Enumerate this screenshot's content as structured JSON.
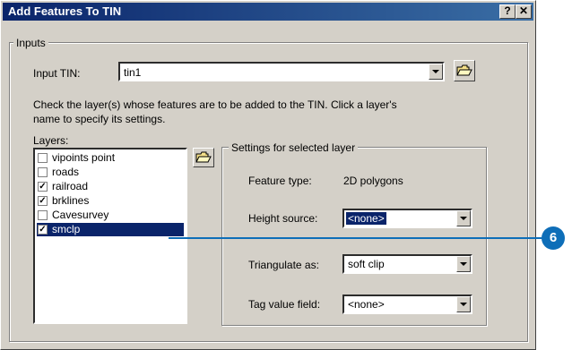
{
  "window": {
    "title": "Add Features To TIN",
    "help_label": "?",
    "close_label": "✕"
  },
  "inputs_group": {
    "label": "Inputs"
  },
  "input_tin": {
    "label": "Input TIN:",
    "value": "tin1"
  },
  "instructions": {
    "line1": "Check the layer(s) whose features are to be added to the TIN. Click a layer's",
    "line2": "name to specify its settings."
  },
  "layers": {
    "label": "Layers:",
    "items": [
      {
        "label": "vipoints point",
        "checked": false,
        "check_glyph": ""
      },
      {
        "label": "roads",
        "checked": false,
        "check_glyph": ""
      },
      {
        "label": "railroad",
        "checked": true,
        "check_glyph": "✓"
      },
      {
        "label": "brklines",
        "checked": true,
        "check_glyph": "✓"
      },
      {
        "label": "Cavesurvey",
        "checked": false,
        "check_glyph": ""
      },
      {
        "label": "smclp",
        "checked": true,
        "check_glyph": "✓",
        "selected": true
      }
    ]
  },
  "settings_group": {
    "label": "Settings for selected layer",
    "feature_type_label": "Feature type:",
    "feature_type_value": "2D polygons",
    "height_source_label": "Height source:",
    "height_source_value": "<none>",
    "triangulate_label": "Triangulate as:",
    "triangulate_value": "soft clip",
    "tag_value_label": "Tag value field:",
    "tag_value_value": "<none>"
  },
  "callout": {
    "number": "6"
  },
  "icons": [
    "open-folder-icon",
    "chevron-down-icon",
    "checkbox-icon",
    "help-icon",
    "close-icon"
  ],
  "colors": {
    "title_bar": "#0a246a",
    "selection": "#0a246a",
    "callout": "#0e6eb8",
    "dialog_face": "#d4d0c8"
  }
}
